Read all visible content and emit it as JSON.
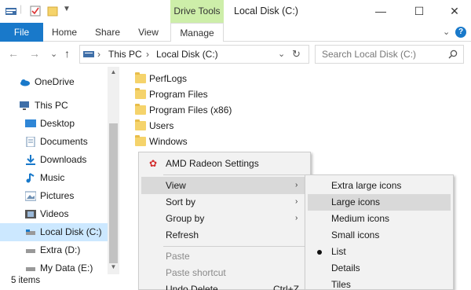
{
  "window": {
    "title": "Local Disk (C:)",
    "context_tab": "Drive Tools",
    "minimize": "—",
    "maximize": "☐",
    "close": "✕"
  },
  "ribbon": {
    "tabs": [
      "File",
      "Home",
      "Share",
      "View",
      "Manage"
    ],
    "expand": "⌄",
    "help": "?"
  },
  "nav": {
    "back": "←",
    "forward": "→",
    "recent": "⌄",
    "up": "↑",
    "path": [
      "This PC",
      "Local Disk (C:)"
    ],
    "separator": "›",
    "dropdown": "⌄",
    "refresh": "↻",
    "search_placeholder": "Search Local Disk (C:)"
  },
  "navpane": {
    "items": [
      {
        "label": "OneDrive",
        "icon": "cloud-icon"
      },
      {
        "label": "This PC",
        "icon": "computer-icon"
      },
      {
        "label": "Desktop",
        "icon": "desktop-icon"
      },
      {
        "label": "Documents",
        "icon": "documents-icon"
      },
      {
        "label": "Downloads",
        "icon": "downloads-icon"
      },
      {
        "label": "Music",
        "icon": "music-icon"
      },
      {
        "label": "Pictures",
        "icon": "pictures-icon"
      },
      {
        "label": "Videos",
        "icon": "videos-icon"
      },
      {
        "label": "Local Disk (C:)",
        "icon": "drive-icon",
        "selected": true
      },
      {
        "label": "Extra (D:)",
        "icon": "drive-icon"
      },
      {
        "label": "My Data (E:)",
        "icon": "drive-icon"
      }
    ]
  },
  "files": [
    "PerfLogs",
    "Program Files",
    "Program Files (x86)",
    "Users",
    "Windows"
  ],
  "status": {
    "items_count": "5 items"
  },
  "context_menu": {
    "header_item": "AMD Radeon Settings",
    "view": "View",
    "sort_by": "Sort by",
    "group_by": "Group by",
    "refresh": "Refresh",
    "paste": "Paste",
    "paste_shortcut": "Paste shortcut",
    "undo_delete": "Undo Delete",
    "undo_shortcut": "Ctrl+Z",
    "arrow": "›"
  },
  "view_submenu": {
    "items": [
      "Extra large icons",
      "Large icons",
      "Medium icons",
      "Small icons",
      "List",
      "Details",
      "Tiles"
    ],
    "highlighted": "Large icons",
    "checked": "List"
  },
  "colors": {
    "accent": "#1979ca",
    "drive_tools": "#cdeea9",
    "selection": "#cce8ff",
    "folder": "#f5d36b"
  }
}
